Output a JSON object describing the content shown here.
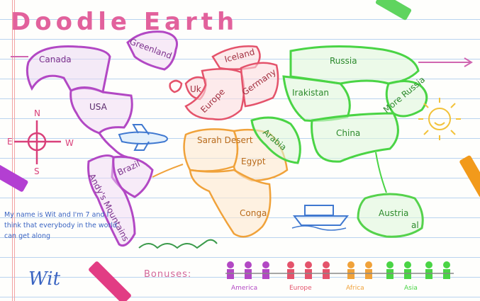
{
  "game": {
    "title": "Doodle Earth",
    "note": "My name is Wit and I'm 7 and I think that everybody in the world can get along",
    "signature": "Wit",
    "bonuses_label": "Bonuses:"
  },
  "compass": {
    "n": "N",
    "e": "E",
    "s": "S",
    "w": "W"
  },
  "regions": {
    "canada": "Canada",
    "greenland": "Greenland",
    "usa": "USA",
    "brazil": "Brazil",
    "andys_mountains": "Andy's Mountains",
    "uk": "Uk",
    "iceland": "Iceland",
    "europe": "Europe",
    "germany": "Germany",
    "sarah_desert": "Sarah\nDesert",
    "egypt": "Egypt",
    "conga": "Conga",
    "arabia": "Arabia",
    "russia": "Russia",
    "irakistan": "Irakistan",
    "more_russia": "More Russia",
    "china": "China",
    "austria": "Austria",
    "austria_suffix": "al"
  },
  "continents": {
    "america": "America",
    "europe": "Europe",
    "africa": "Africa",
    "asia": "Asia"
  },
  "colors": {
    "america": "#b248c4",
    "europe": "#e4536b",
    "africa": "#f0a23a",
    "asia": "#4ad445",
    "australia": "#55d24c",
    "title": "#e2619c",
    "note": "#3a64c2"
  }
}
